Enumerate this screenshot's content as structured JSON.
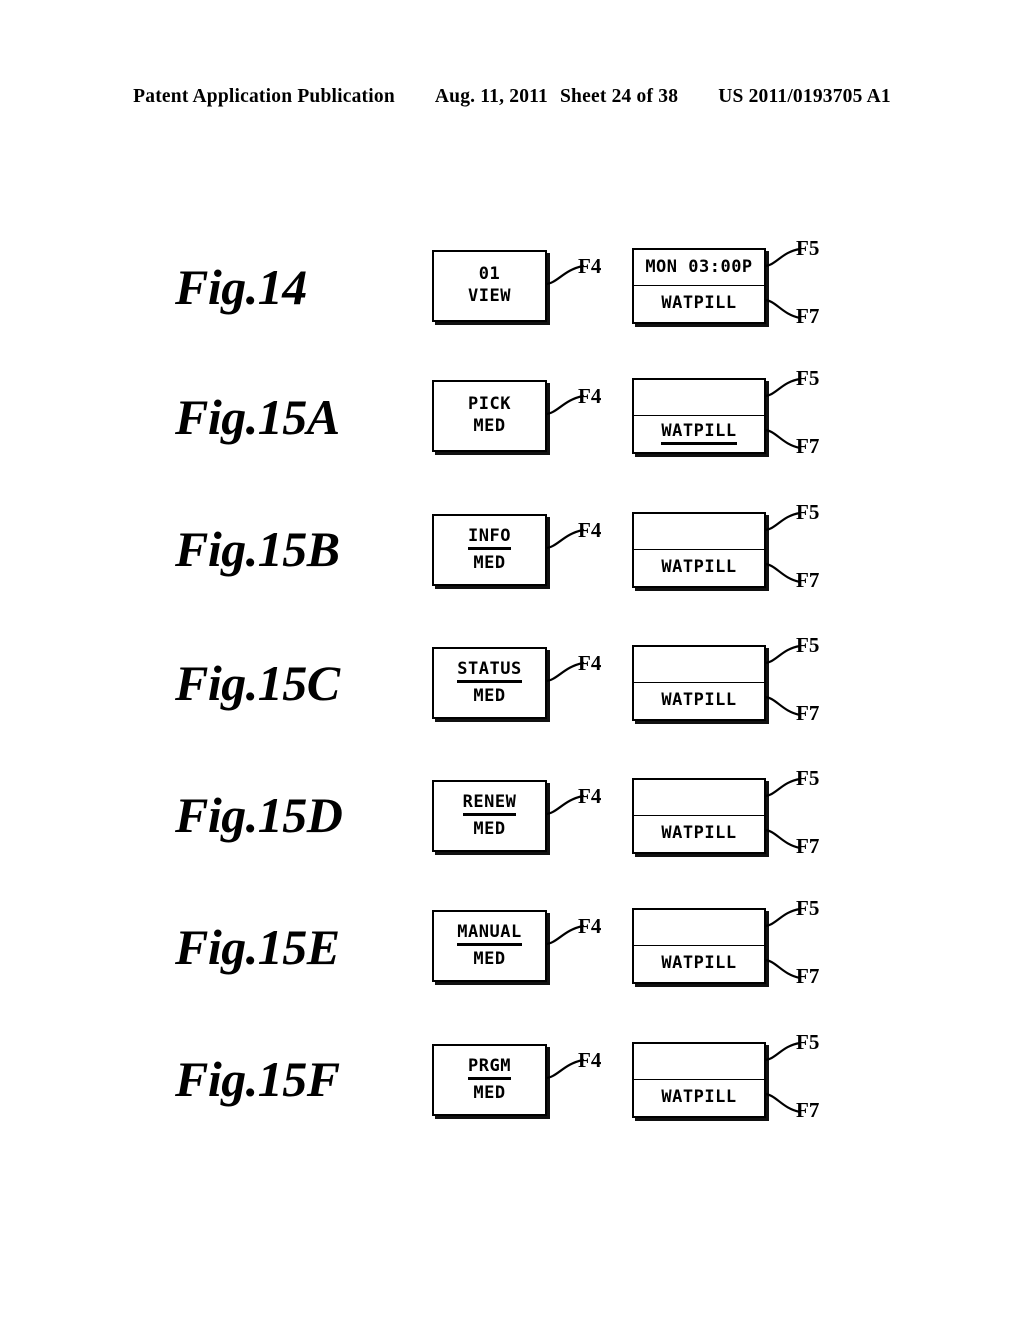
{
  "header": {
    "publication": "Patent Application Publication",
    "date": "Aug. 11, 2011",
    "sheet": "Sheet 24 of 38",
    "number": "US 2011/0193705 A1"
  },
  "labels": {
    "f4": "F4",
    "f5": "F5",
    "f7": "F7"
  },
  "figures": [
    {
      "caption": "Fig.14",
      "left_display": {
        "line1": "01",
        "line2": "VIEW",
        "ruled": false
      },
      "right_display": {
        "top": "MON 03:00P",
        "bottom": "WATPILL",
        "bottom_underlined": false
      }
    },
    {
      "caption": "Fig.15A",
      "left_display": {
        "line1": "PICK",
        "line2": "MED",
        "ruled": false
      },
      "right_display": {
        "top": "",
        "bottom": "WATPILL",
        "bottom_underlined": true
      }
    },
    {
      "caption": "Fig.15B",
      "left_display": {
        "line1": "INFO",
        "line2": "MED",
        "ruled": true
      },
      "right_display": {
        "top": "",
        "bottom": "WATPILL",
        "bottom_underlined": false
      }
    },
    {
      "caption": "Fig.15C",
      "left_display": {
        "line1": "STATUS",
        "line2": "MED",
        "ruled": true
      },
      "right_display": {
        "top": "",
        "bottom": "WATPILL",
        "bottom_underlined": false
      }
    },
    {
      "caption": "Fig.15D",
      "left_display": {
        "line1": "RENEW",
        "line2": "MED",
        "ruled": true
      },
      "right_display": {
        "top": "",
        "bottom": "WATPILL",
        "bottom_underlined": false
      }
    },
    {
      "caption": "Fig.15E",
      "left_display": {
        "line1": "MANUAL",
        "line2": "MED",
        "ruled": true
      },
      "right_display": {
        "top": "",
        "bottom": "WATPILL",
        "bottom_underlined": false
      }
    },
    {
      "caption": "Fig.15F",
      "left_display": {
        "line1": "PRGM",
        "line2": "MED",
        "ruled": true
      },
      "right_display": {
        "top": "",
        "bottom": "WATPILL",
        "bottom_underlined": false
      }
    }
  ],
  "layout": {
    "row_tops": [
      248,
      378,
      512,
      645,
      778,
      908,
      1042
    ],
    "caption_tops": [
      262,
      392,
      524,
      658,
      790,
      922,
      1054
    ]
  }
}
